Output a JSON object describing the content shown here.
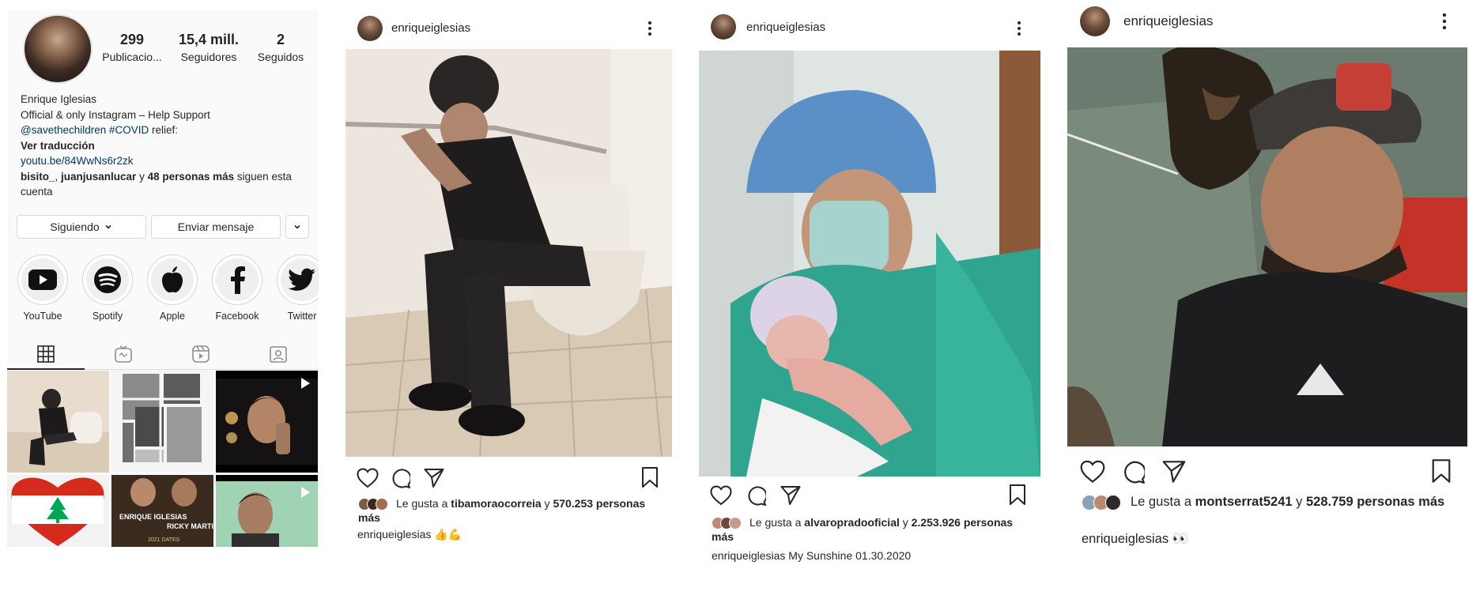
{
  "profile": {
    "stats": [
      {
        "value": "299",
        "label": "Publicacio..."
      },
      {
        "value": "15,4 mill.",
        "label": "Seguidores"
      },
      {
        "value": "2",
        "label": "Seguidos"
      }
    ],
    "bio": {
      "name": "Enrique Iglesias",
      "line1": "Official & only Instagram – Help Support",
      "mention": "@savethechildren",
      "hashtag": "#COVID",
      "line2_rest": " relief:",
      "translate": "Ver traducción",
      "link": "youtu.be/84WwNs6r2zk",
      "followers_a": "bisito_",
      "followers_sep": ", ",
      "followers_b": "juanjusanlucar",
      "followers_mid": " y ",
      "followers_more": "48 personas más",
      "followers_tail": " siguen esta cuenta"
    },
    "buttons": {
      "following": "Siguiendo",
      "message": "Enviar mensaje"
    },
    "highlights": [
      {
        "label": "YouTube",
        "icon": "youtube-icon"
      },
      {
        "label": "Spotify",
        "icon": "spotify-icon"
      },
      {
        "label": "Apple",
        "icon": "apple-icon"
      },
      {
        "label": "Facebook",
        "icon": "facebook-icon"
      },
      {
        "label": "Twitter",
        "icon": "twitter-icon"
      }
    ],
    "grid_tabs": [
      "grid-icon",
      "igtv-icon",
      "reels-icon",
      "tagged-icon"
    ],
    "thumb_text": {
      "enrique": "ENRIQUE IGLESIAS",
      "ricky": "RICKY MARTIN",
      "dates": "2021 DATES"
    }
  },
  "posts": [
    {
      "username": "enriqueiglesias",
      "likes_prefix": "Le gusta a ",
      "likes_user": "tibamoraocorreia",
      "likes_mid": " y ",
      "likes_count": "570.253 personas más",
      "caption_user": "enriqueiglesias",
      "caption_text": " 👍💪"
    },
    {
      "username": "enriqueiglesias",
      "likes_prefix": "Le gusta a ",
      "likes_user": "alvaropradooficial",
      "likes_mid": " y ",
      "likes_count": "2.253.926 personas más",
      "caption_user": "enriqueiglesias",
      "caption_text": " My Sunshine 01.30.2020"
    },
    {
      "username": "enriqueiglesias",
      "likes_prefix": "Le gusta a ",
      "likes_user": "montserrat5241",
      "likes_mid": " y ",
      "likes_count": "528.759 personas más",
      "caption_user": "enriqueiglesias",
      "caption_text": " 👀"
    }
  ],
  "colors": {
    "link": "#00376b",
    "text": "#262626",
    "border": "#dbdbdb",
    "scrubs": "#2fa58f"
  }
}
